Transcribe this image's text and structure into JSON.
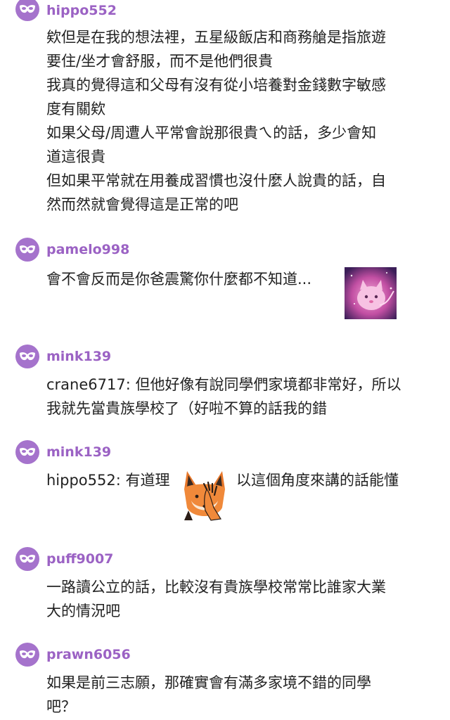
{
  "comments": [
    {
      "username": "hippo552",
      "lines": [
        "欸但是在我的想法裡，五星級飯店和商務艙是指旅遊",
        "要住/坐才會舒服，而不是他們很貴",
        "我真的覺得這和父母有沒有從小培養對金錢數字敏感",
        "度有關欸",
        "如果父母/周遭人平常會說那很貴ㄟ的話，多少會知",
        "道這很貴",
        "但如果平常就在用養成習慣也沒什麼人說貴的話，自",
        "然而然就會覺得這是正常的吧"
      ]
    },
    {
      "username": "pamelo998",
      "text": "會不會反而是你爸震驚你什麼都不知道...",
      "sticker": "pink-glowing-cat-sticker"
    },
    {
      "username": "mink139",
      "lines": [
        "crane6717: 但他好像有說同學們家境都非常好，所以",
        "我就先當貴族學校了（好啦不算的話我的錯"
      ]
    },
    {
      "username": "mink139",
      "text_before": "hippo552: 有道理",
      "text_after": "以這個角度來講的話能懂",
      "sticker": "fox-facepalm-sticker"
    },
    {
      "username": "puff9007",
      "lines": [
        "一路讀公立的話，比較沒有貴族學校常常比誰家大業",
        "大的情況吧"
      ]
    },
    {
      "username": "prawn6056",
      "lines": [
        "如果是前三志願，那確實會有滿多家境不錯的同學",
        "吧？"
      ]
    }
  ],
  "avatar_icon": "masquerade-mask-icon",
  "colors": {
    "avatar_bg": "#a573cc",
    "username": "#9b62c4",
    "text": "#222222"
  }
}
